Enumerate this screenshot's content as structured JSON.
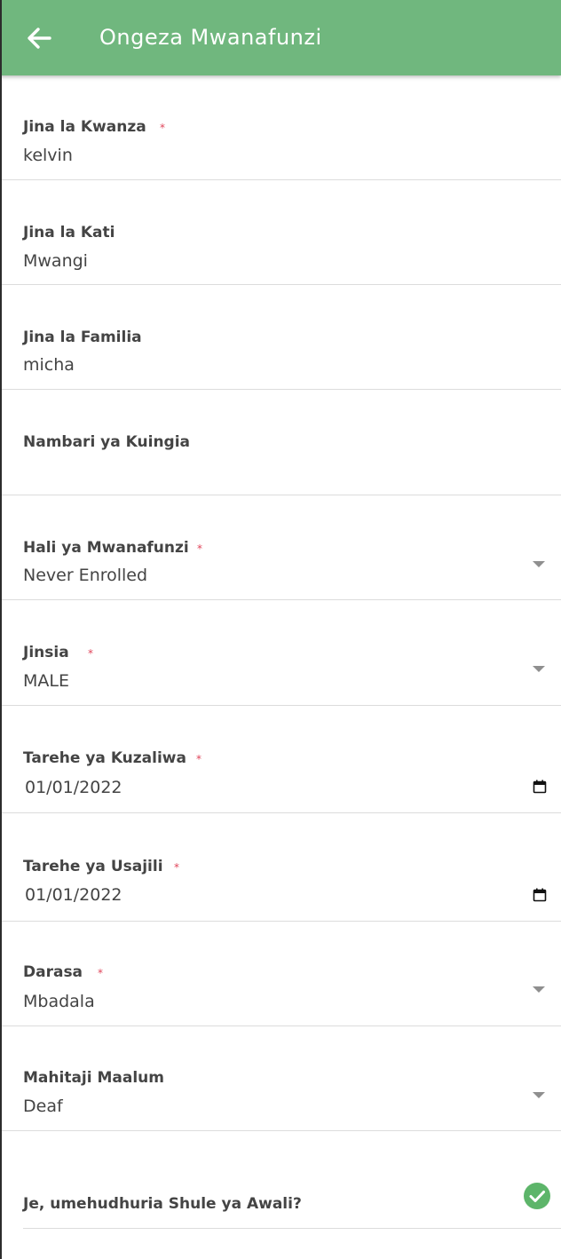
{
  "app_bar": {
    "title": "Ongeza Mwanafunzi",
    "back_icon": "arrow-left-icon",
    "color": "#70b77e"
  },
  "required_marker": "*",
  "fields": {
    "first_name": {
      "label": "Jina la Kwanza",
      "value": "kelvin",
      "required": true
    },
    "middle_name": {
      "label": "Jina la Kati",
      "value": "Mwangi",
      "required": false
    },
    "last_name": {
      "label": "Jina la Familia",
      "value": "micha",
      "required": false
    },
    "admission_number": {
      "label": "Nambari ya Kuingia",
      "value": "",
      "required": false
    },
    "student_status": {
      "label": "Hali ya Mwanafunzi",
      "value": "Never Enrolled",
      "required": true
    },
    "gender": {
      "label": "Jinsia",
      "value": "MALE",
      "required": true
    },
    "birth_date": {
      "label": "Tarehe ya Kuzaliwa",
      "value": "01/01/2022",
      "required": true
    },
    "registration_date": {
      "label": "Tarehe ya Usajili",
      "value": "01/01/2022",
      "required": true
    },
    "class": {
      "label": "Darasa",
      "value": "Mbadala",
      "required": true
    },
    "special_needs": {
      "label": "Mahitaji Maalum",
      "value": "Deaf",
      "required": false
    }
  },
  "preschool": {
    "label": "Je, umehudhuria Shule ya Awali?",
    "checked": true,
    "check_color": "#5db56a"
  }
}
